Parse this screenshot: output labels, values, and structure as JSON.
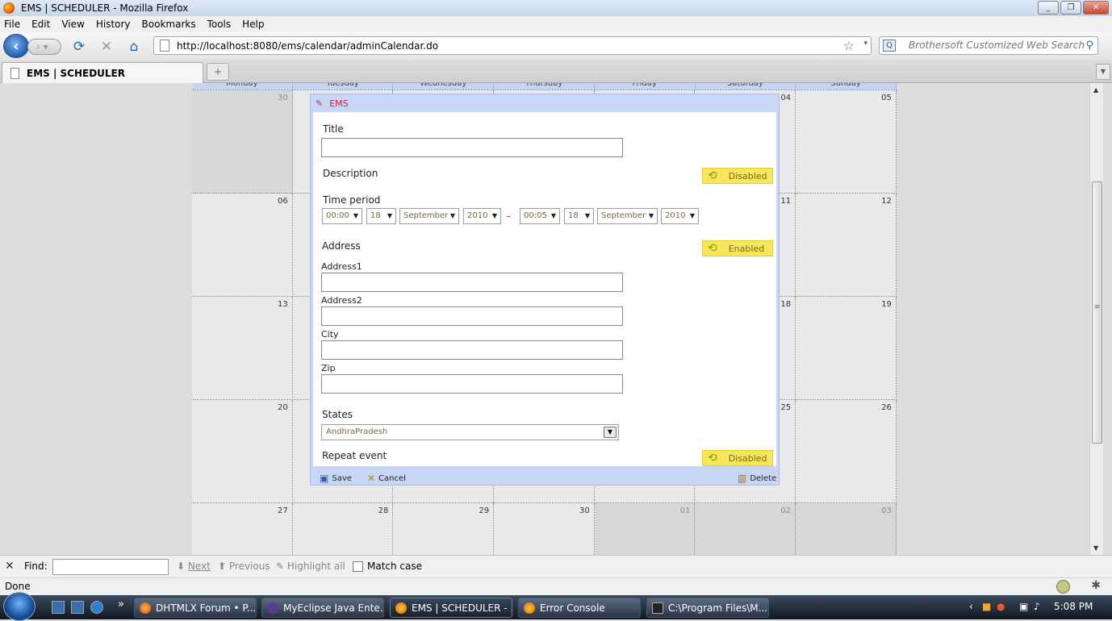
{
  "window": {
    "title": "EMS | SCHEDULER - Mozilla Firefox",
    "min": "_",
    "max": "❐",
    "close": "✕"
  },
  "menu": [
    "File",
    "Edit",
    "View",
    "History",
    "Bookmarks",
    "Tools",
    "Help"
  ],
  "nav": {
    "url": "http://localhost:8080/ems/calendar/adminCalendar.do",
    "search_placeholder": "Brothersoft Customized Web Search"
  },
  "tab": {
    "title": "EMS | SCHEDULER"
  },
  "calendar": {
    "day_headers": [
      "Monday",
      "Tuesday",
      "Wednesday",
      "Thursday",
      "Friday",
      "Saturday",
      "Sunday"
    ],
    "rows": [
      [
        "30",
        "",
        "",
        "",
        "",
        "04",
        "05"
      ],
      [
        "06",
        "",
        "",
        "",
        "",
        "11",
        "12"
      ],
      [
        "13",
        "",
        "",
        "",
        "",
        "18",
        "19"
      ],
      [
        "20",
        "",
        "",
        "",
        "",
        "25",
        "26"
      ],
      [
        "27",
        "28",
        "29",
        "30",
        "01",
        "02",
        "03"
      ]
    ]
  },
  "lightbox": {
    "header": "EMS",
    "title_label": "Title",
    "description_label": "Description",
    "description_toggle": "Disabled",
    "time_period_label": "Time period",
    "start": {
      "time": "00:00",
      "day": "18",
      "month": "September",
      "year": "2010"
    },
    "dash": "–",
    "end": {
      "time": "00:05",
      "day": "18",
      "month": "September",
      "year": "2010"
    },
    "address_label": "Address",
    "address_toggle": "Enabled",
    "address1_label": "Address1",
    "address2_label": "Address2",
    "city_label": "City",
    "zip_label": "Zip",
    "states_label": "States",
    "state_value": "AndhraPradesh",
    "repeat_label": "Repeat event",
    "repeat_toggle": "Disabled",
    "save": "Save",
    "cancel": "Cancel",
    "delete": "Delete"
  },
  "findbar": {
    "close": "✕",
    "label": "Find:",
    "next": "Next",
    "previous": "Previous",
    "highlight": "Highlight all",
    "match_case": "Match case"
  },
  "status": {
    "text": "Done"
  },
  "taskbar": {
    "items": [
      "DHTMLX Forum • P...",
      "MyEclipse Java Ente...",
      "EMS | SCHEDULER - ...",
      "Error Console",
      "C:\\Program Files\\M..."
    ],
    "time": "5:08 PM"
  }
}
